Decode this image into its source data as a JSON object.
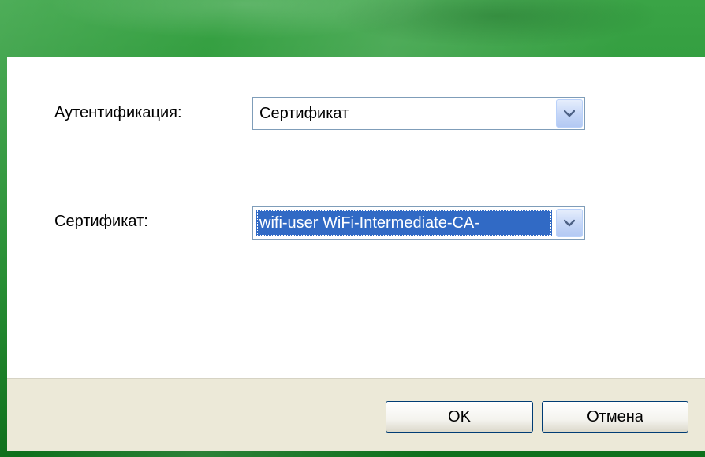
{
  "dialog": {
    "authentication_label": "Аутентификация:",
    "authentication_value": "Сертификат",
    "certificate_label": "Сертификат:",
    "certificate_value": "wifi-user  WiFi-Intermediate-CA-",
    "ok_label": "OK",
    "cancel_label": "Отмена"
  },
  "icons": {
    "dropdown": "chevron-down-icon"
  },
  "colors": {
    "frame_green": "#2f9a3a",
    "selection_blue": "#316ac5",
    "combo_border": "#7f9db9",
    "footer_bg": "#ece9d8"
  }
}
